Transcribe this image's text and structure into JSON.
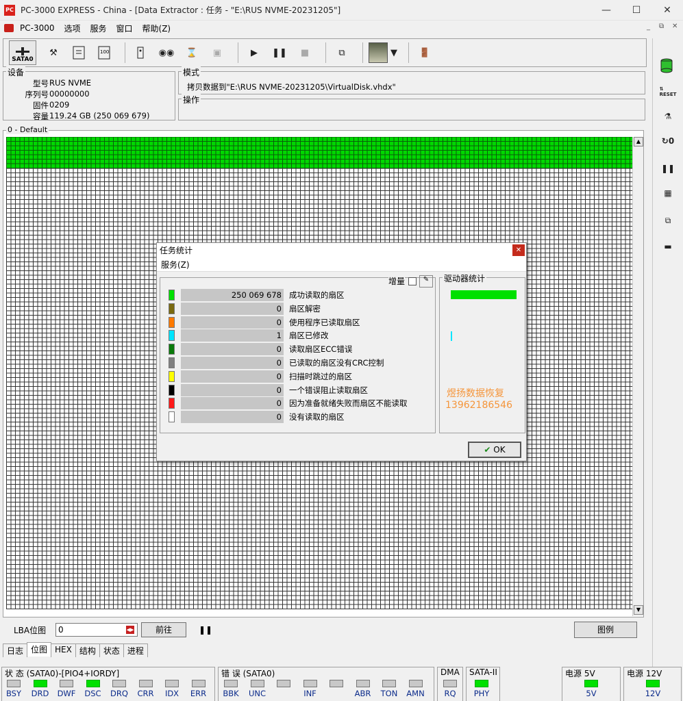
{
  "window": {
    "title": "PC-3000 EXPRESS - China - [Data Extractor : 任务 - \"E:\\RUS NVME-20231205\"]",
    "icon_text": "PC"
  },
  "menu": [
    "PC-3000",
    "选项",
    "服务",
    "窗口",
    "帮助(Z)"
  ],
  "toolbar": {
    "sata_label": "SATA0"
  },
  "device": {
    "title": "设备",
    "model_label": "型号",
    "model": "RUS NVME",
    "serial_label": "序列号",
    "serial": "00000000",
    "firmware_label": "固件",
    "firmware": "0209",
    "capacity_label": "容量",
    "capacity": "119.24 GB (250 069 679)"
  },
  "mode": {
    "title": "模式",
    "text": "拷贝数据到\"E:\\RUS NVME-20231205\\VirtualDisk.vhdx\""
  },
  "operation": {
    "title": "操作"
  },
  "bitmap": {
    "title": "0 - Default"
  },
  "lba": {
    "label": "LBA位图",
    "value": "0",
    "go_label": "前往",
    "legend_label": "图例"
  },
  "tabs": [
    "日志",
    "位图",
    "HEX",
    "结构",
    "状态",
    "进程"
  ],
  "dialog": {
    "title": "任务统计",
    "menu": "服务(Z)",
    "increment_label": "增量",
    "drive_stats_title": "驱动器统计",
    "rows": [
      {
        "color": "#00e000",
        "value": "250 069 678",
        "label": "成功读取的扇区"
      },
      {
        "color": "#7a6a10",
        "value": "0",
        "label": "扇区解密"
      },
      {
        "color": "#ff7a00",
        "value": "0",
        "label": "使用程序已读取扇区"
      },
      {
        "color": "#00e5ff",
        "value": "1",
        "label": "扇区已修改"
      },
      {
        "color": "#0a7a0a",
        "value": "0",
        "label": "读取扇区ECC错误"
      },
      {
        "color": "#808080",
        "value": "0",
        "label": "已读取的扇区没有CRC控制"
      },
      {
        "color": "#ffff00",
        "value": "0",
        "label": "扫描时跳过的扇区"
      },
      {
        "color": "#000000",
        "value": "0",
        "label": "一个错误阻止读取扇区"
      },
      {
        "color": "#ff1a1a",
        "value": "0",
        "label": "因为准备就绪失败而扇区不能读取"
      },
      {
        "color": "#ffffff",
        "value": "0",
        "label": "没有读取的扇区"
      }
    ],
    "watermark_name": "煜扬数据恢复",
    "watermark_phone": "13962186546",
    "ok_label": "OK"
  },
  "status": {
    "state_title": "状 态 (SATA0)-[PIO4+IORDY]",
    "state_leds": [
      {
        "label": "BSY",
        "on": false
      },
      {
        "label": "DRD",
        "on": true
      },
      {
        "label": "DWF",
        "on": false
      },
      {
        "label": "DSC",
        "on": true
      },
      {
        "label": "DRQ",
        "on": false
      },
      {
        "label": "CRR",
        "on": false
      },
      {
        "label": "IDX",
        "on": false
      },
      {
        "label": "ERR",
        "on": false
      }
    ],
    "error_title": "错 误 (SATA0)",
    "error_leds": [
      {
        "label": "BBK",
        "on": false
      },
      {
        "label": "UNC",
        "on": false
      },
      {
        "label": "",
        "on": false
      },
      {
        "label": "INF",
        "on": false
      },
      {
        "label": "",
        "on": false
      },
      {
        "label": "ABR",
        "on": false
      },
      {
        "label": "TON",
        "on": false
      },
      {
        "label": "AMN",
        "on": false
      }
    ],
    "dma_title": "DMA",
    "dma_led": "RQ",
    "sata_title": "SATA-II",
    "sata_led": "PHY",
    "p5_title": "电源 5V",
    "p5_led": "5V",
    "p12_title": "电源 12V",
    "p12_led": "12V"
  },
  "colors": {
    "accent_green": "#00e000",
    "close_red": "#c42b1c"
  }
}
